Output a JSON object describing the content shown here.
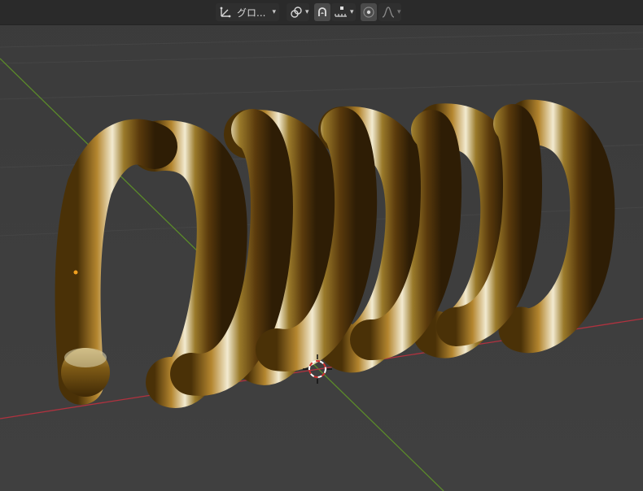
{
  "header": {
    "transform_orientation": {
      "icon": "transform-orientation-icon",
      "label": "グロ..."
    },
    "pivot_icon": "pivot-point-icon",
    "snap": {
      "magnet_icon": "snap-magnet-icon",
      "increment_icon": "snap-increment-icon"
    },
    "proportional": {
      "toggle_icon": "proportional-editing-icon",
      "falloff_icon": "falloff-curve-icon"
    }
  },
  "viewport": {
    "scene": "gold-coil-spring",
    "axis_colors": {
      "x": "#b0323f",
      "y": "#5b8a2a"
    },
    "cursor_icon": "3d-cursor-icon",
    "origin_icon": "object-origin-icon"
  }
}
